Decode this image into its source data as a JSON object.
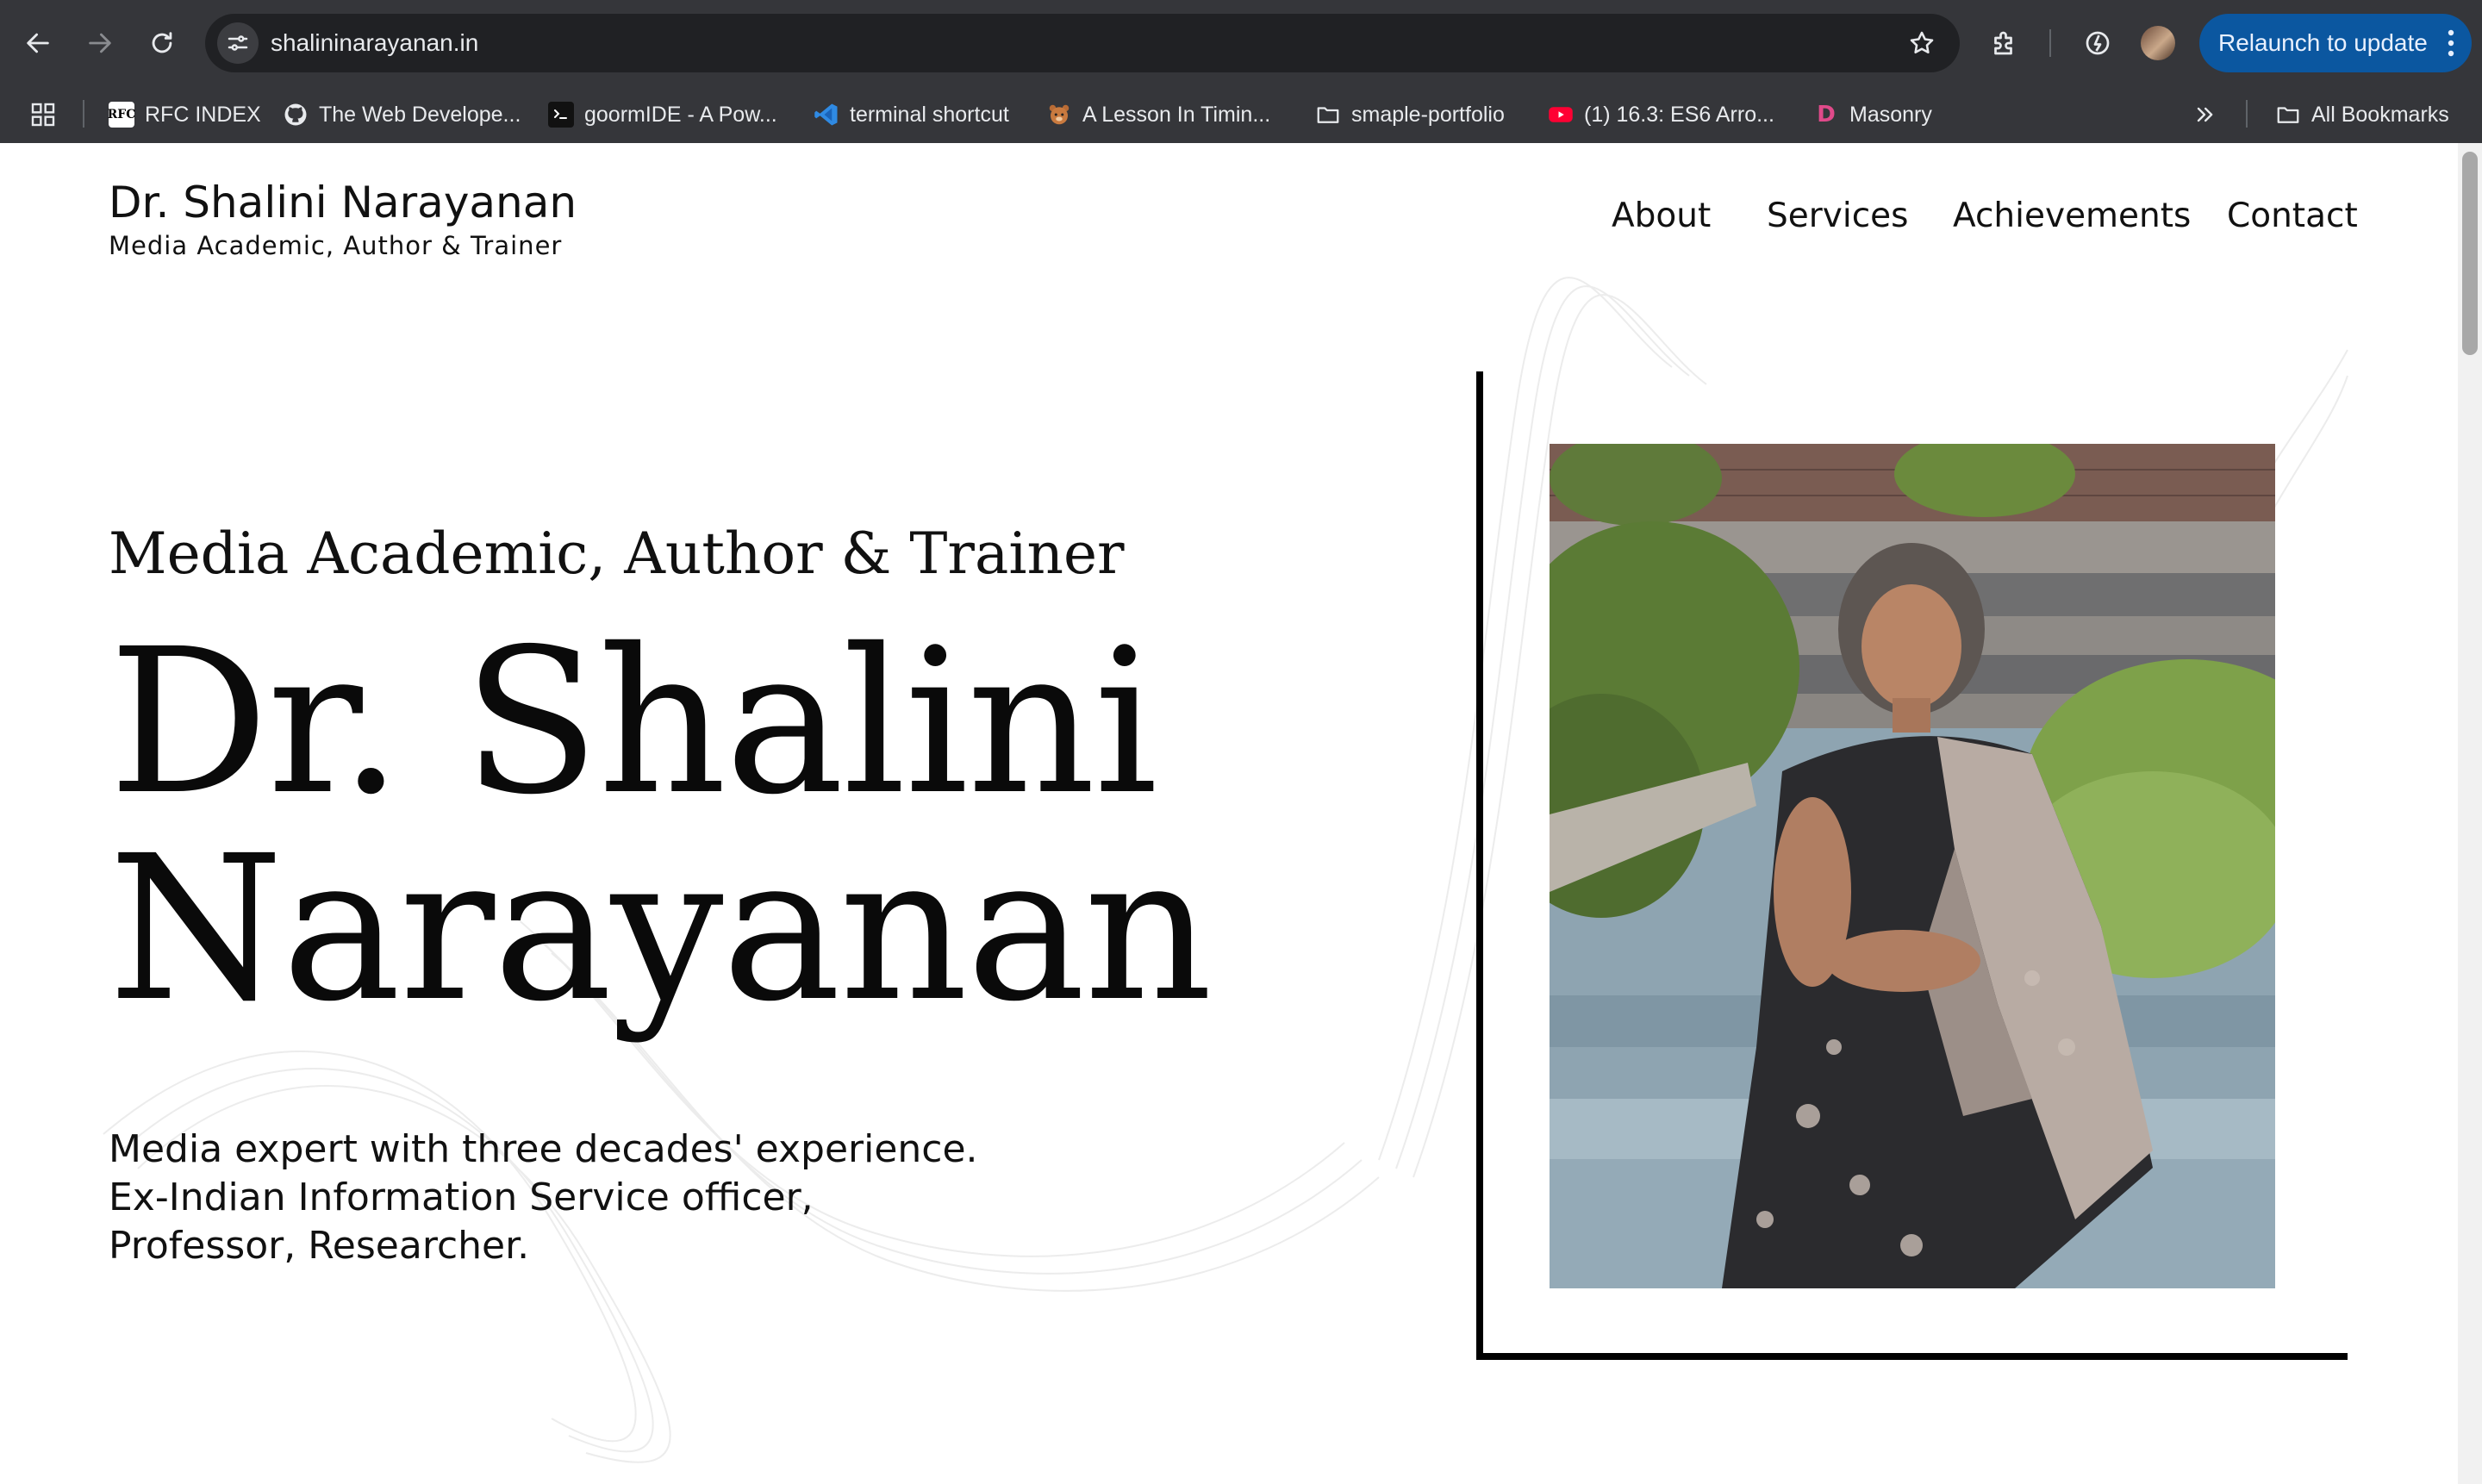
{
  "browser": {
    "url": "shalininarayanan.in",
    "relaunch_label": "Relaunch to update",
    "bookmarks": [
      {
        "label": "RFC INDEX",
        "icon": "rfc-favicon"
      },
      {
        "label": "The Web Develope...",
        "icon": "github-icon"
      },
      {
        "label": "goormIDE - A Pow...",
        "icon": "terminal-icon"
      },
      {
        "label": "terminal shortcut",
        "icon": "vscode-icon"
      },
      {
        "label": "A Lesson In Timin...",
        "icon": "bear-icon"
      },
      {
        "label": "smaple-portfolio",
        "icon": "folder-icon"
      },
      {
        "label": "(1) 16.3: ES6 Arro...",
        "icon": "youtube-icon"
      },
      {
        "label": "Masonry",
        "icon": "masonry-favicon"
      }
    ],
    "all_bookmarks_label": "All Bookmarks",
    "colors": {
      "chrome": "#35363a",
      "omnibox": "#202124",
      "relaunch": "#0b57a0"
    }
  },
  "site": {
    "brand_name": "Dr. Shalini Narayanan",
    "brand_tagline": "Media Academic, Author & Trainer",
    "nav": [
      "About",
      "Services",
      "Achievements",
      "Contact"
    ],
    "hero": {
      "subtitle": "Media Academic, Author & Trainer",
      "title_lines": [
        "Dr. Shalini",
        "Narayanan"
      ],
      "description_lines": [
        "Media expert with three decades' experience.",
        "Ex-Indian Information Service officer,",
        "Professor, Researcher."
      ]
    }
  }
}
